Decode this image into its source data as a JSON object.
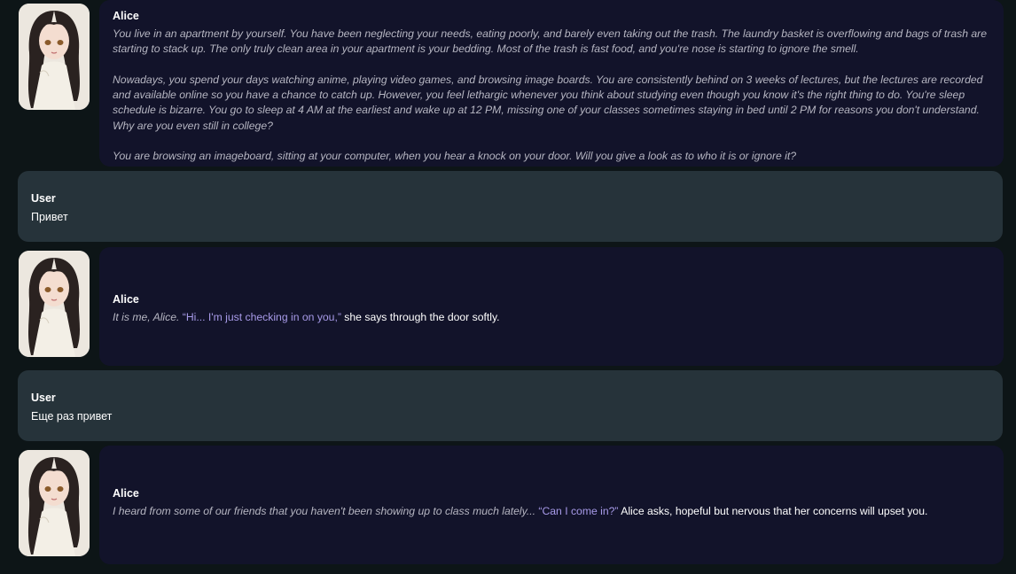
{
  "messages": [
    {
      "role": "bot",
      "name": "Alice",
      "paragraphs": [
        "You live in an apartment by yourself. You have been neglecting your needs, eating poorly, and barely even taking out the trash. The laundry basket is overflowing and bags of trash are starting to stack up. The only truly clean area in your apartment is your bedding. Most of the trash is fast food, and you're nose is starting to ignore the smell.",
        "Nowadays, you spend your days watching anime, playing video games, and browsing image boards. You are consistently behind on 3 weeks of lectures, but the lectures are recorded and available online so you have a chance to catch up. However, you feel lethargic whenever you think about studying even though you know it's the right thing to do. You're sleep schedule is bizarre. You go to sleep at 4 AM at the earliest and wake up at 12 PM, missing one of your classes sometimes staying in bed until 2 PM for reasons you don't understand. Why are you even still in college?",
        "You are browsing an imageboard, sitting at your computer, when you hear a knock on your door. Will you give a look as to who it is or ignore it?"
      ]
    },
    {
      "role": "user",
      "name": "User",
      "text": "Привет"
    },
    {
      "role": "bot",
      "name": "Alice",
      "narration": "It is me, Alice. ",
      "quote": "“Hi... I'm just checking in on you,”",
      "plain": " she says through the door softly."
    },
    {
      "role": "user",
      "name": "User",
      "text": "Еще раз привет"
    },
    {
      "role": "bot",
      "name": "Alice",
      "narration": "I heard from some of our friends that you haven't been showing up to class much lately... ",
      "quote": "“Can I come in?”",
      "plain": " Alice asks, hopeful but nervous that her concerns will upset you."
    }
  ],
  "colors": {
    "background": "#0d1517",
    "bot_bubble": "#12132a",
    "user_bubble": "#26333a",
    "narration": "#b6b6c2",
    "quote": "#a79ae8",
    "text": "#ffffff"
  }
}
